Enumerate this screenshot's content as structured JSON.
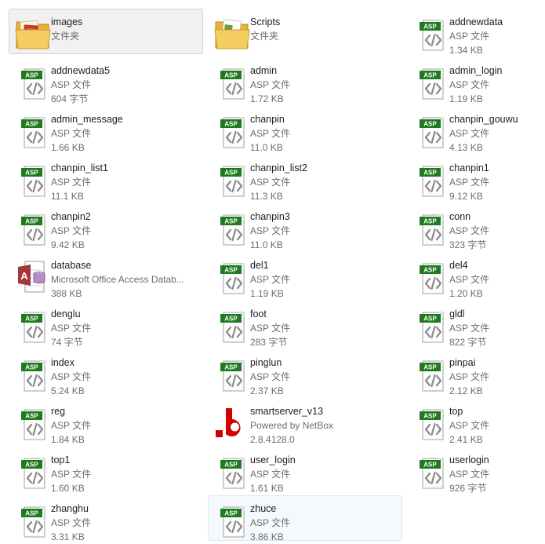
{
  "colors": {
    "asp_badge": "#1f7a1f",
    "selection_bg": "#f1f1f1",
    "hover_bg": "#f5f9fd",
    "netbox_red": "#d40000"
  },
  "files": [
    {
      "name": "images",
      "line2": "文件夹",
      "line3": "",
      "icon": "folder-icon",
      "state": "selected"
    },
    {
      "name": "Scripts",
      "line2": "文件夹",
      "line3": "",
      "icon": "scripts-folder-icon"
    },
    {
      "name": "addnewdata",
      "line2": "ASP 文件",
      "line3": "1.34 KB",
      "icon": "asp-file-icon"
    },
    {
      "name": "addnewdata5",
      "line2": "ASP 文件",
      "line3": "604 字节",
      "icon": "asp-file-icon"
    },
    {
      "name": "admin",
      "line2": "ASP 文件",
      "line3": "1.72 KB",
      "icon": "asp-file-icon"
    },
    {
      "name": "admin_login",
      "line2": "ASP 文件",
      "line3": "1.19 KB",
      "icon": "asp-file-icon"
    },
    {
      "name": "admin_message",
      "line2": "ASP 文件",
      "line3": "1.66 KB",
      "icon": "asp-file-icon"
    },
    {
      "name": "chanpin",
      "line2": "ASP 文件",
      "line3": "11.0 KB",
      "icon": "asp-file-icon"
    },
    {
      "name": "chanpin_gouwu",
      "line2": "ASP 文件",
      "line3": "4.13 KB",
      "icon": "asp-file-icon"
    },
    {
      "name": "chanpin_list1",
      "line2": "ASP 文件",
      "line3": "11.1 KB",
      "icon": "asp-file-icon"
    },
    {
      "name": "chanpin_list2",
      "line2": "ASP 文件",
      "line3": "11.3 KB",
      "icon": "asp-file-icon"
    },
    {
      "name": "chanpin1",
      "line2": "ASP 文件",
      "line3": "9.12 KB",
      "icon": "asp-file-icon"
    },
    {
      "name": "chanpin2",
      "line2": "ASP 文件",
      "line3": "9.42 KB",
      "icon": "asp-file-icon"
    },
    {
      "name": "chanpin3",
      "line2": "ASP 文件",
      "line3": "11.0 KB",
      "icon": "asp-file-icon"
    },
    {
      "name": "conn",
      "line2": "ASP 文件",
      "line3": "323 字节",
      "icon": "asp-file-icon"
    },
    {
      "name": "database",
      "line2": "Microsoft Office Access Datab...",
      "line3": "388 KB",
      "icon": "access-database-icon"
    },
    {
      "name": "del1",
      "line2": "ASP 文件",
      "line3": "1.19 KB",
      "icon": "asp-file-icon"
    },
    {
      "name": "del4",
      "line2": "ASP 文件",
      "line3": "1.20 KB",
      "icon": "asp-file-icon"
    },
    {
      "name": "denglu",
      "line2": "ASP 文件",
      "line3": "74 字节",
      "icon": "asp-file-icon"
    },
    {
      "name": "foot",
      "line2": "ASP 文件",
      "line3": "283 字节",
      "icon": "asp-file-icon"
    },
    {
      "name": "gldl",
      "line2": "ASP 文件",
      "line3": "822 字节",
      "icon": "asp-file-icon"
    },
    {
      "name": "index",
      "line2": "ASP 文件",
      "line3": "5.24 KB",
      "icon": "asp-file-icon"
    },
    {
      "name": "pinglun",
      "line2": "ASP 文件",
      "line3": "2.37 KB",
      "icon": "asp-file-icon"
    },
    {
      "name": "pinpai",
      "line2": "ASP 文件",
      "line3": "2.12 KB",
      "icon": "asp-file-icon"
    },
    {
      "name": "reg",
      "line2": "ASP 文件",
      "line3": "1.84 KB",
      "icon": "asp-file-icon"
    },
    {
      "name": "smartserver_v13",
      "line2": "Powered by NetBox",
      "line3": "2.8.4128.0",
      "icon": "netbox-app-icon"
    },
    {
      "name": "top",
      "line2": "ASP 文件",
      "line3": "2.41 KB",
      "icon": "asp-file-icon"
    },
    {
      "name": "top1",
      "line2": "ASP 文件",
      "line3": "1.60 KB",
      "icon": "asp-file-icon"
    },
    {
      "name": "user_login",
      "line2": "ASP 文件",
      "line3": "1.61 KB",
      "icon": "asp-file-icon"
    },
    {
      "name": "userlogin",
      "line2": "ASP 文件",
      "line3": "926 字节",
      "icon": "asp-file-icon"
    },
    {
      "name": "zhanghu",
      "line2": "ASP 文件",
      "line3": "3.31 KB",
      "icon": "asp-file-icon"
    },
    {
      "name": "zhuce",
      "line2": "ASP 文件",
      "line3": "3.86 KB",
      "icon": "asp-file-icon",
      "state": "hover"
    }
  ]
}
